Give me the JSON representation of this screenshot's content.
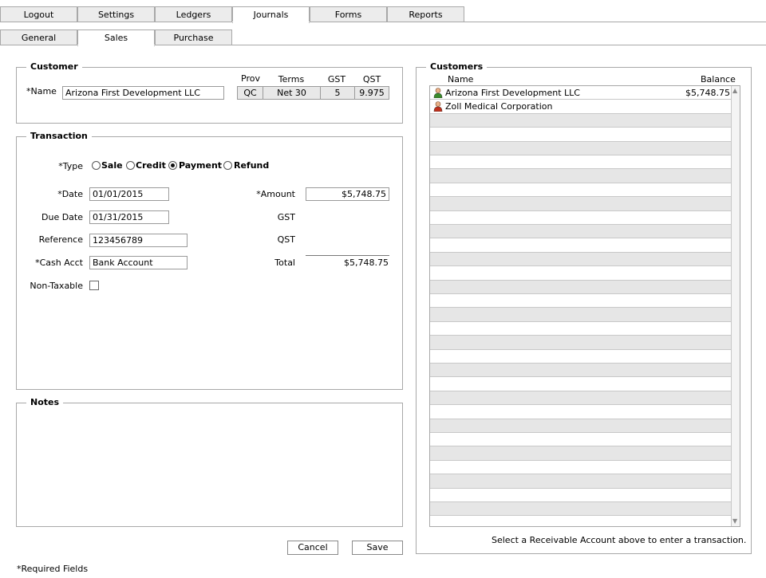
{
  "tabs_main": [
    "Logout",
    "Settings",
    "Ledgers",
    "Journals",
    "Forms",
    "Reports"
  ],
  "tabs_main_active": "Journals",
  "tabs_sub": [
    "General",
    "Sales",
    "Purchase"
  ],
  "tabs_sub_active": "Sales",
  "customer": {
    "legend": "Customer",
    "name_label": "*Name",
    "name_value": "Arizona First Development LLC",
    "headers": [
      "Prov",
      "Terms",
      "GST",
      "QST"
    ],
    "values": [
      "QC",
      "Net 30",
      "5",
      "9.975"
    ]
  },
  "transaction": {
    "legend": "Transaction",
    "type_label": "*Type",
    "types": [
      "Sale",
      "Credit",
      "Payment",
      "Refund"
    ],
    "type_selected": "Payment",
    "date_label": "*Date",
    "date_value": "01/01/2015",
    "due_label": "Due Date",
    "due_value": "01/31/2015",
    "ref_label": "Reference",
    "ref_value": "123456789",
    "cash_label": "*Cash Acct",
    "cash_value": "Bank Account",
    "nontax_label": "Non-Taxable",
    "amount_label": "*Amount",
    "amount_value": "$5,748.75",
    "gst_label": "GST",
    "qst_label": "QST",
    "total_label": "Total",
    "total_value": "$5,748.75"
  },
  "notes": {
    "legend": "Notes"
  },
  "buttons": {
    "cancel": "Cancel",
    "save": "Save"
  },
  "required_note": "*Required Fields",
  "customers_panel": {
    "legend": "Customers",
    "col_name": "Name",
    "col_balance": "Balance",
    "rows": [
      {
        "name": "Arizona First Development LLC",
        "balance": "$5,748.75",
        "icon_color": "#3a8a2a"
      },
      {
        "name": "Zoll Medical Corporation",
        "balance": "",
        "icon_color": "#c0301c"
      }
    ],
    "hint": "Select a Receivable Account above to enter a transaction."
  }
}
